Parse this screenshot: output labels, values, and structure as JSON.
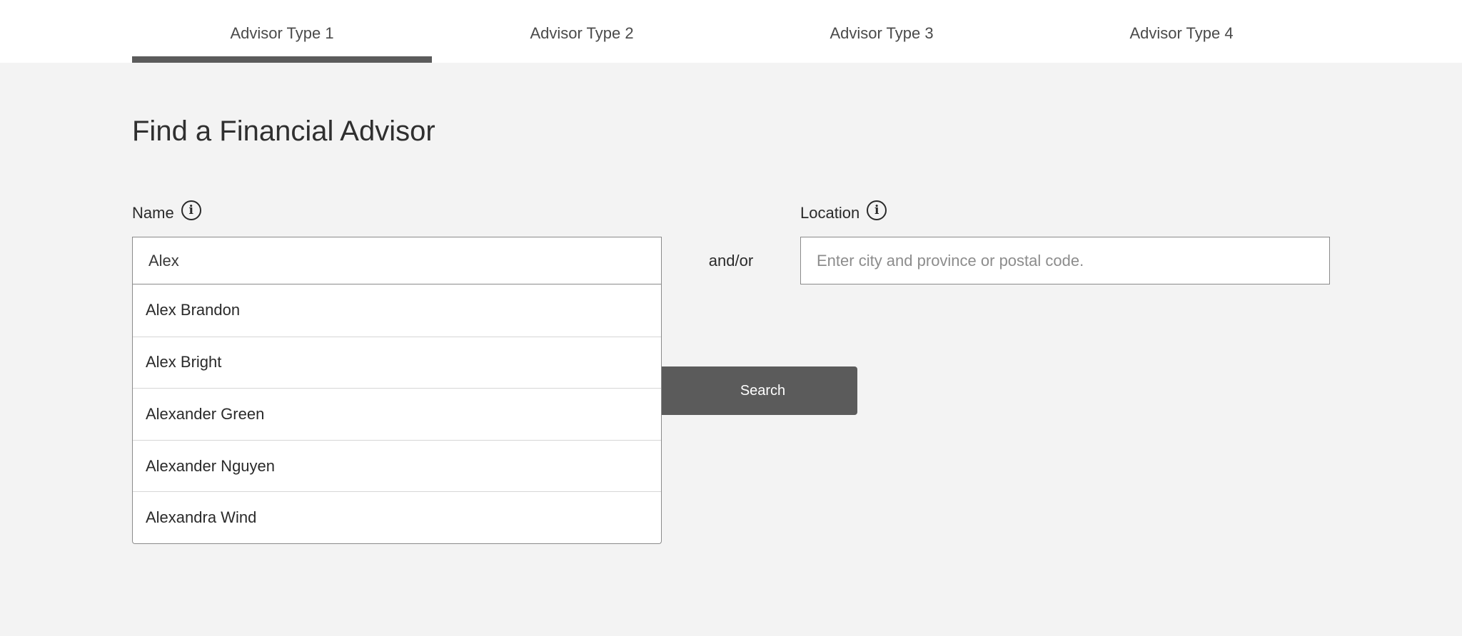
{
  "tabs": [
    {
      "label": "Advisor Type 1",
      "active": true
    },
    {
      "label": "Advisor Type 2",
      "active": false
    },
    {
      "label": "Advisor Type 3",
      "active": false
    },
    {
      "label": "Advisor Type 4",
      "active": false
    }
  ],
  "page_title": "Find a Financial Advisor",
  "name_field": {
    "label": "Name",
    "value": "Alex",
    "icon": "info-icon"
  },
  "separator": "and/or",
  "location_field": {
    "label": "Location",
    "value": "",
    "placeholder": "Enter city and province or postal code.",
    "icon": "info-icon"
  },
  "search_button": {
    "label": "Search"
  },
  "suggestions": [
    "Alex Brandon",
    "Alex Bright",
    "Alexander Green",
    "Alexander Nguyen",
    "Alexandra Wind"
  ],
  "colors": {
    "page_background": "#f3f3f3",
    "tab_active_indicator": "#5b5b5b",
    "button_background": "#5b5b5b"
  }
}
